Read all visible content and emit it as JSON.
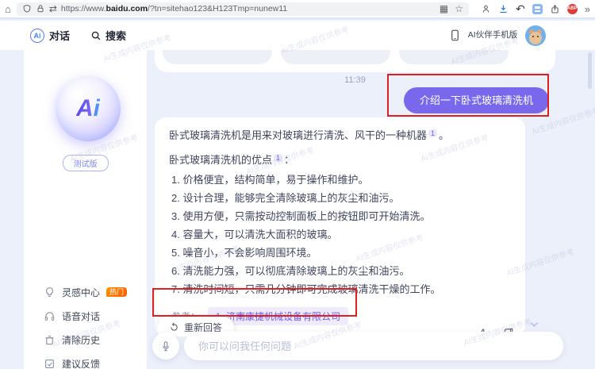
{
  "browser": {
    "url_protocol": "https://www.",
    "url_domain": "baidu.com",
    "url_path": "/?tn=sitehao123&H123Tmp=nunew11",
    "glyphs": {
      "home": "⌂",
      "swap": "⇄",
      "qr": "▦",
      "star": "☆",
      "undo": "↶",
      "more": "»",
      "abp": "ABP"
    }
  },
  "topnav": {
    "chat_tab": "对话",
    "search_label": "搜索",
    "mobile_companion": "AI伙伴手机版"
  },
  "sidebar": {
    "logo": "Ai",
    "beta_badge": "测试版",
    "items": [
      {
        "label": "灵感中心",
        "badge": "热门"
      },
      {
        "label": "语音对话",
        "badge": ""
      },
      {
        "label": "清除历史",
        "badge": ""
      },
      {
        "label": "建议反馈",
        "badge": ""
      }
    ]
  },
  "chat": {
    "timestamp": "11:39",
    "user_message": "介绍一下卧式玻璃清洗机",
    "answer": {
      "intro": "卧式玻璃清洗机是用来对玻璃进行清洗、风干的一种机器",
      "intro_ref": "1",
      "intro_end": "。",
      "points_title": "卧式玻璃清洗机的优点",
      "points_ref": "1",
      "points_end": "：",
      "points": [
        "1. 价格便宜，结构简单，易于操作和维护。",
        "2. 设计合理，能够完全清除玻璃上的灰尘和油污。",
        "3. 使用方便，只需按动控制面板上的按钮即可开始清洗。",
        "4. 容量大，可以清洗大面积的玻璃。",
        "5. 噪音小，不会影响周围环境。",
        "6. 清洗能力强，可以彻底清除玻璃上的灰尘和油污。",
        "7. 清洗时间短，只需几分钟即可完成玻璃清洗干燥的工作。"
      ],
      "reference_label": "参考：",
      "reference_index": "1",
      "reference_name": "济南康捷机械设备有限公司"
    },
    "regenerate_label": "重新回答",
    "input_placeholder": "你可以问我任何问题"
  },
  "watermark": "AI生成内容仅供参考",
  "colors": {
    "accent_purple": "#7a68ec",
    "reference_purple": "#6d5bee",
    "annotation_red": "#e02020",
    "hot_badge_orange": "#ff6f1e",
    "page_background": "#ecf0fa"
  }
}
